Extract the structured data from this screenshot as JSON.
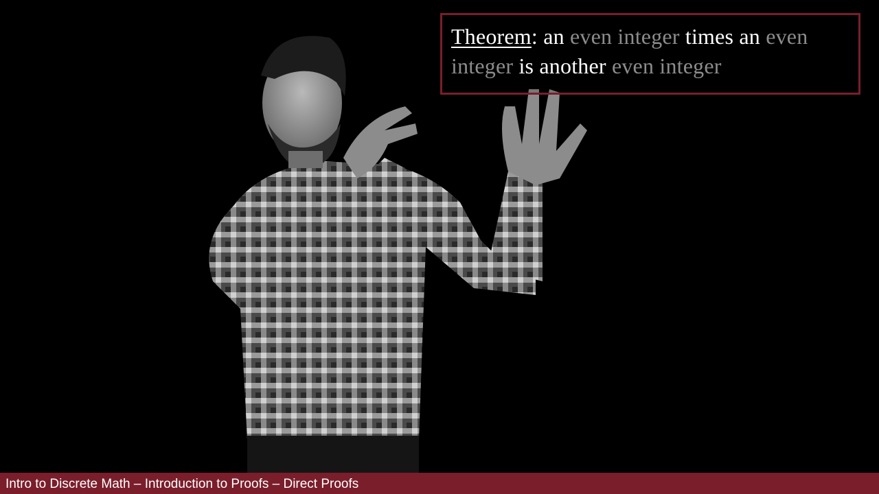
{
  "theorem": {
    "label": "Theorem",
    "colon": ":",
    "parts": [
      {
        "text": " an ",
        "muted": false
      },
      {
        "text": "even integer",
        "muted": true
      },
      {
        "text": " times an ",
        "muted": false
      },
      {
        "text": "even integer",
        "muted": true
      },
      {
        "text": " is another ",
        "muted": false
      },
      {
        "text": "even integer",
        "muted": true
      }
    ]
  },
  "caption": {
    "text": "Intro to Discrete Math – Introduction to Proofs – Direct Proofs"
  },
  "colors": {
    "accent": "#7a1e2c",
    "background": "#000000",
    "text": "#ffffff",
    "muted_text": "#8c8c8c"
  }
}
